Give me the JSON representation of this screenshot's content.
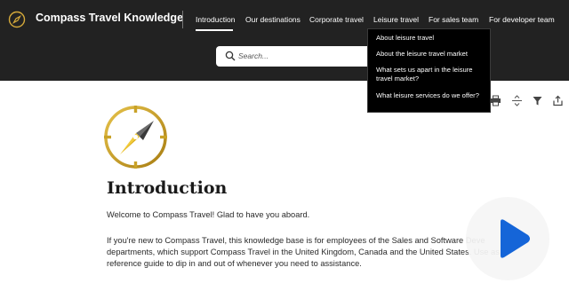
{
  "header": {
    "title": "Compass Travel Knowledge",
    "logo_icon": "compass-icon",
    "background_color": "#222222"
  },
  "nav": {
    "items": [
      {
        "label": "Introduction",
        "active": true
      },
      {
        "label": "Our destinations",
        "active": false
      },
      {
        "label": "Corporate travel",
        "active": false
      },
      {
        "label": "Leisure travel",
        "active": false
      },
      {
        "label": "For sales team",
        "active": false
      },
      {
        "label": "For developer team",
        "active": false
      }
    ]
  },
  "search": {
    "placeholder": "Search...",
    "icon": "search-icon"
  },
  "dropdown": {
    "items": [
      "About leisure travel",
      "About the leisure travel market",
      "What sets us apart in the leisure travel market?",
      "What leisure services do we offer?"
    ]
  },
  "toolbar": {
    "icons": [
      "print-icon",
      "expand-collapse-icon",
      "filter-icon",
      "share-icon"
    ]
  },
  "content": {
    "heading": "Introduction",
    "welcome": "Welcome to Compass Travel! Glad to have you aboard.",
    "intro_lines": [
      "If you're new to Compass Travel, this knowledge base is for employees of the Sales and Software Deve",
      "departments, which support Compass Travel in the United Kingdom, Canada and the United States. Use as a",
      "reference guide to dip in and out of whenever you need to assistance."
    ]
  },
  "video_overlay": {
    "icon": "play-icon",
    "color": "#1565d8"
  },
  "colors": {
    "accent_gold": "#c9a227",
    "header_bg": "#222222",
    "dropdown_bg": "#000000"
  }
}
